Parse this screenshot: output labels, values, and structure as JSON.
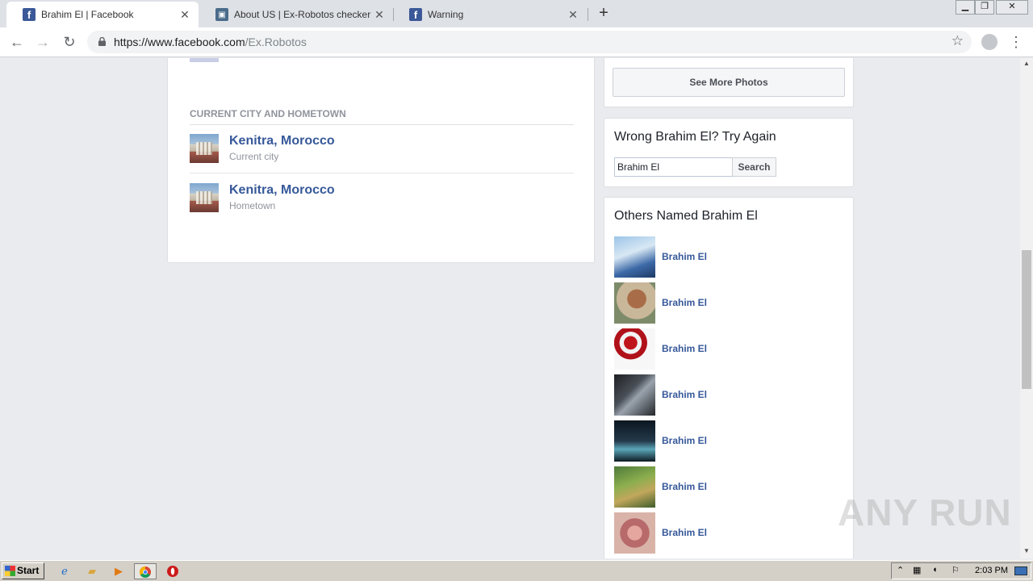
{
  "browser": {
    "tabs": [
      {
        "title": "Brahim El | Facebook",
        "icon": "facebook-icon"
      },
      {
        "title": "About US | Ex-Robotos checker",
        "icon": "site-icon"
      },
      {
        "title": "Warning",
        "icon": "facebook-icon"
      }
    ],
    "url_host": "https://www.facebook.com",
    "url_path": "/Ex.Robotos"
  },
  "about": {
    "section_title": "CURRENT CITY AND HOMETOWN",
    "places": [
      {
        "name": "Kenitra, Morocco",
        "type": "Current city"
      },
      {
        "name": "Kenitra, Morocco",
        "type": "Hometown"
      }
    ]
  },
  "photos": {
    "see_more_label": "See More Photos"
  },
  "wrong_person": {
    "heading": "Wrong Brahim El? Try Again",
    "search_value": "Brahim El",
    "search_button": "Search"
  },
  "others": {
    "heading": "Others Named Brahim El",
    "people": [
      {
        "name": "Brahim El"
      },
      {
        "name": "Brahim El"
      },
      {
        "name": "Brahim El"
      },
      {
        "name": "Brahim El"
      },
      {
        "name": "Brahim El"
      },
      {
        "name": "Brahim El"
      },
      {
        "name": "Brahim El"
      }
    ]
  },
  "watermark": "ANY RUN",
  "taskbar": {
    "start_label": "Start",
    "clock": "2:03 PM"
  },
  "colors": {
    "link": "#365899",
    "facebook_blue": "#3b5998",
    "page_bg": "#e9ebee"
  }
}
